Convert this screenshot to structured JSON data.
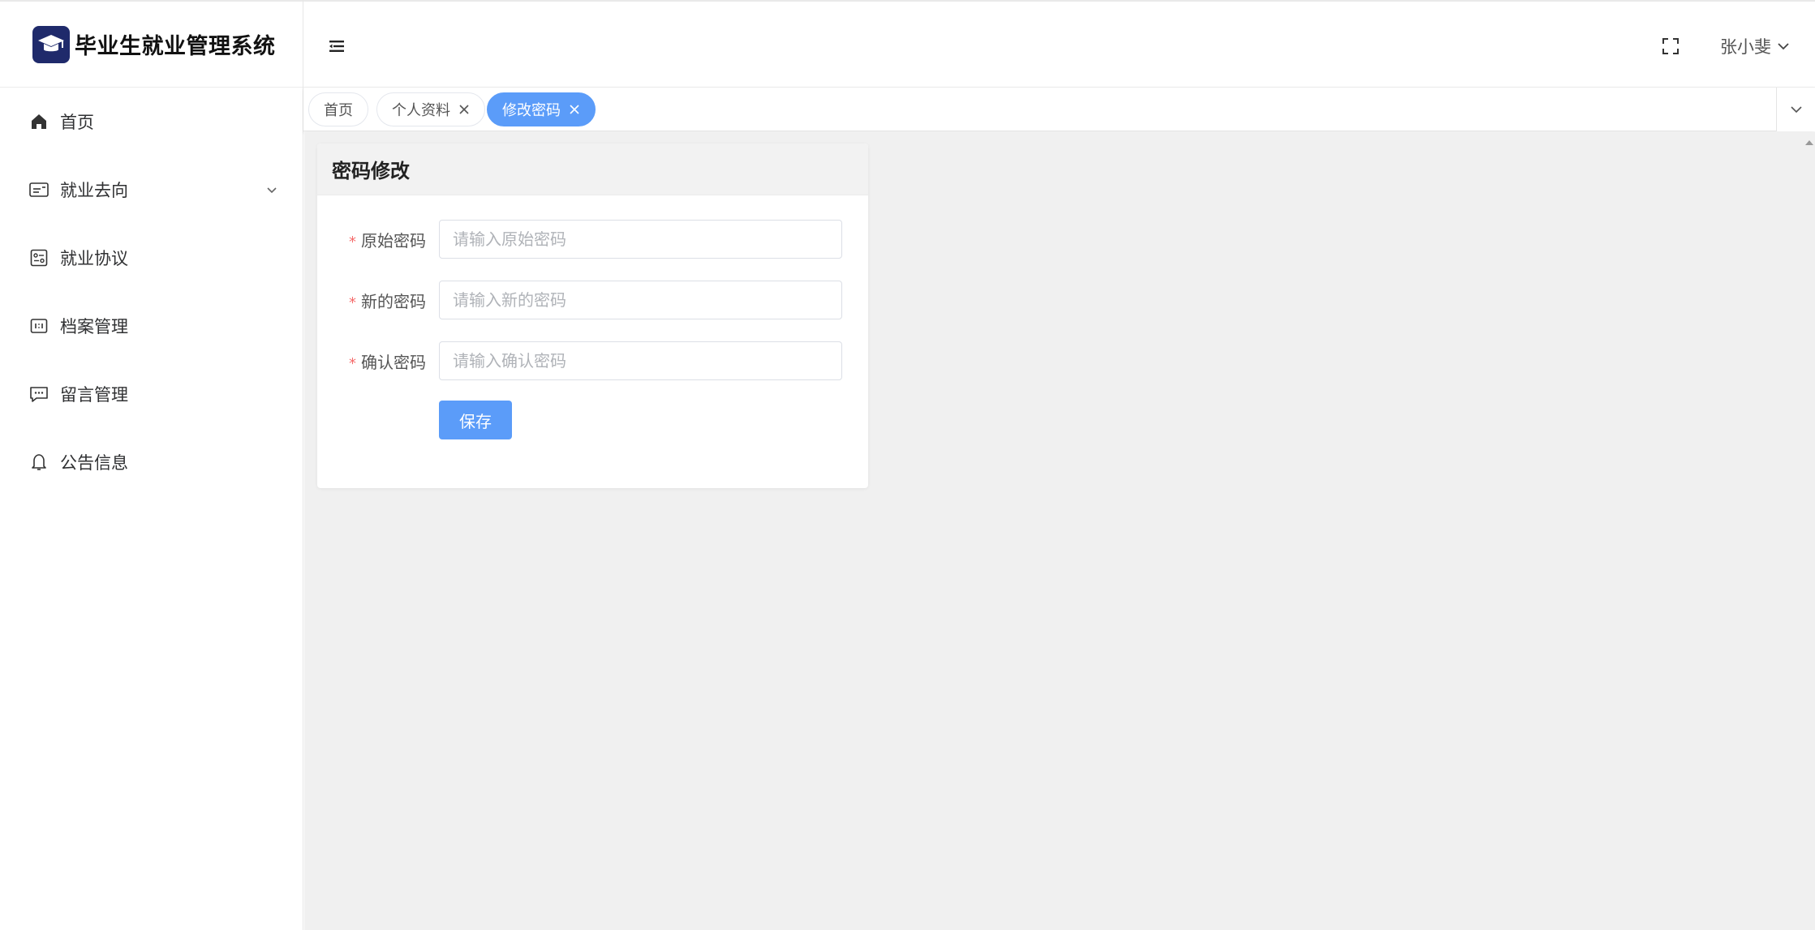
{
  "app": {
    "title": "毕业生就业管理系统"
  },
  "sidebar": {
    "items": [
      {
        "label": "首页",
        "icon": "home-icon"
      },
      {
        "label": "就业去向",
        "icon": "card-icon",
        "expandable": true
      },
      {
        "label": "就业协议",
        "icon": "agreement-icon"
      },
      {
        "label": "档案管理",
        "icon": "archive-icon"
      },
      {
        "label": "留言管理",
        "icon": "message-icon"
      },
      {
        "label": "公告信息",
        "icon": "bell-icon"
      }
    ]
  },
  "header": {
    "user_name": "张小斐",
    "icons": [
      "hamburger-icon",
      "fullscreen-icon",
      "chevron-down-icon"
    ]
  },
  "tabs": [
    {
      "label": "首页",
      "closable": false,
      "active": false
    },
    {
      "label": "个人资料",
      "closable": true,
      "active": false
    },
    {
      "label": "修改密码",
      "closable": true,
      "active": true
    }
  ],
  "card": {
    "title": "密码修改",
    "fields": [
      {
        "label": "原始密码",
        "placeholder": "请输入原始密码",
        "value": "",
        "required": true
      },
      {
        "label": "新的密码",
        "placeholder": "请输入新的密码",
        "value": "",
        "required": true
      },
      {
        "label": "确认密码",
        "placeholder": "请输入确认密码",
        "value": "",
        "required": true
      }
    ],
    "save_label": "保存",
    "required_mark": "*"
  },
  "colors": {
    "primary": "#5b9cf9",
    "logo_bg": "#1f2a6b",
    "required": "#f56c6c",
    "main_bg": "#f0f0f0"
  }
}
